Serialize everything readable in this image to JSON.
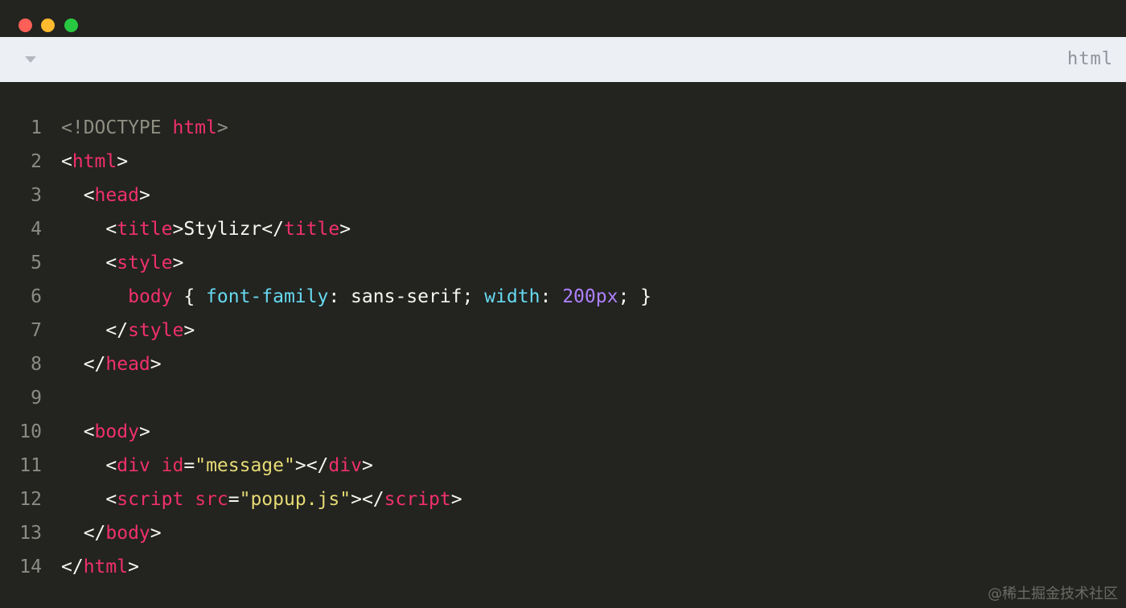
{
  "window": {
    "controls": [
      "close",
      "minimize",
      "maximize"
    ],
    "colors": {
      "close": "#fe5f57",
      "minimize": "#febb2e",
      "maximize": "#28c840",
      "background": "#232320",
      "codebar": "#eceff3"
    }
  },
  "codebar": {
    "collapse_icon": "chevron-down-icon",
    "language": "html"
  },
  "code": {
    "lines": [
      {
        "n": "1",
        "tokens": [
          [
            "doc",
            "<!DOCTYPE "
          ],
          [
            "t",
            "html"
          ],
          [
            "doc",
            ">"
          ]
        ]
      },
      {
        "n": "2",
        "tokens": [
          [
            "p",
            "<"
          ],
          [
            "t",
            "html"
          ],
          [
            "p",
            ">"
          ]
        ]
      },
      {
        "n": "3",
        "tokens": [
          [
            "p",
            "  <"
          ],
          [
            "t",
            "head"
          ],
          [
            "p",
            ">"
          ]
        ]
      },
      {
        "n": "4",
        "tokens": [
          [
            "p",
            "    <"
          ],
          [
            "t",
            "title"
          ],
          [
            "p",
            ">"
          ],
          [
            "txt",
            "Stylizr"
          ],
          [
            "p",
            "</"
          ],
          [
            "t",
            "title"
          ],
          [
            "p",
            ">"
          ]
        ]
      },
      {
        "n": "5",
        "tokens": [
          [
            "p",
            "    <"
          ],
          [
            "t",
            "style"
          ],
          [
            "p",
            ">"
          ]
        ]
      },
      {
        "n": "6",
        "tokens": [
          [
            "p",
            "      "
          ],
          [
            "t",
            "body"
          ],
          [
            "p",
            " { "
          ],
          [
            "prop",
            "font-family"
          ],
          [
            "p",
            ": sans-serif; "
          ],
          [
            "prop",
            "width"
          ],
          [
            "p",
            ": "
          ],
          [
            "num",
            "200px"
          ],
          [
            "p",
            "; }"
          ]
        ]
      },
      {
        "n": "7",
        "tokens": [
          [
            "p",
            "    </"
          ],
          [
            "t",
            "style"
          ],
          [
            "p",
            ">"
          ]
        ]
      },
      {
        "n": "8",
        "tokens": [
          [
            "p",
            "  </"
          ],
          [
            "t",
            "head"
          ],
          [
            "p",
            ">"
          ]
        ]
      },
      {
        "n": "9",
        "tokens": []
      },
      {
        "n": "10",
        "tokens": [
          [
            "p",
            "  <"
          ],
          [
            "t",
            "body"
          ],
          [
            "p",
            ">"
          ]
        ]
      },
      {
        "n": "11",
        "tokens": [
          [
            "p",
            "    <"
          ],
          [
            "t",
            "div"
          ],
          [
            "p",
            " "
          ],
          [
            "a",
            "id"
          ],
          [
            "p",
            "="
          ],
          [
            "s",
            "\"message\""
          ],
          [
            "p",
            "></"
          ],
          [
            "t",
            "div"
          ],
          [
            "p",
            ">"
          ]
        ]
      },
      {
        "n": "12",
        "tokens": [
          [
            "p",
            "    <"
          ],
          [
            "t",
            "script"
          ],
          [
            "p",
            " "
          ],
          [
            "a",
            "src"
          ],
          [
            "p",
            "="
          ],
          [
            "s",
            "\"popup.js\""
          ],
          [
            "p",
            "></"
          ],
          [
            "t",
            "script"
          ],
          [
            "p",
            ">"
          ]
        ]
      },
      {
        "n": "13",
        "tokens": [
          [
            "p",
            "  </"
          ],
          [
            "t",
            "body"
          ],
          [
            "p",
            ">"
          ]
        ]
      },
      {
        "n": "14",
        "tokens": [
          [
            "p",
            "</"
          ],
          [
            "t",
            "html"
          ],
          [
            "p",
            ">"
          ]
        ]
      }
    ]
  },
  "watermark": "@稀土掘金技术社区"
}
